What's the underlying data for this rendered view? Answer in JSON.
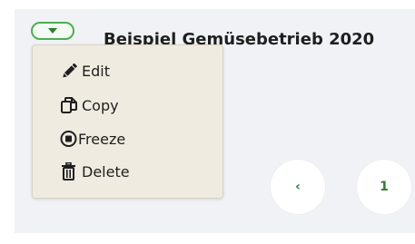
{
  "header": {
    "title": "Beispiel Gemüsebetrieb 2020",
    "toggle_icon": "chevron-down-icon"
  },
  "menu": {
    "items": [
      {
        "label": "Edit",
        "icon": "pencil-icon"
      },
      {
        "label": "Copy",
        "icon": "copy-icon"
      },
      {
        "label": "Freeze",
        "icon": "stop-circle-icon"
      },
      {
        "label": "Delete",
        "icon": "trash-icon"
      }
    ]
  },
  "pagination": {
    "prev_label": "‹",
    "page_label": "1"
  },
  "colors": {
    "accent": "#4caf50",
    "accent_dark": "#2e7d32",
    "menu_bg": "#efebe0",
    "panel_bg": "#f1f2f5"
  }
}
